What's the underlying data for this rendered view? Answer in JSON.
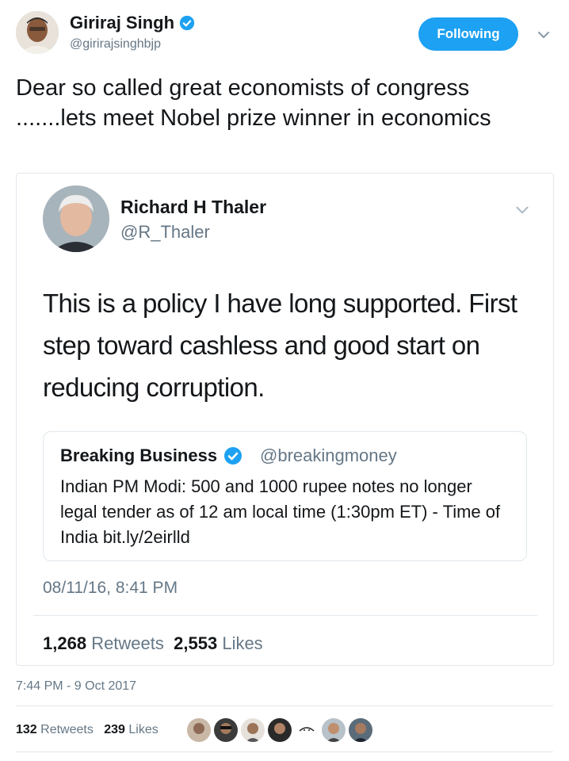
{
  "tweet": {
    "author_name": "Giriraj Singh",
    "author_handle": "@girirajsinghbjp",
    "follow_label": "Following",
    "text": "Dear so called great economists of congress .......lets meet Nobel prize winner in economics",
    "time": "7:44 PM - 9 Oct 2017",
    "retweets_count": "132",
    "retweets_label": "Retweets",
    "likes_count": "239",
    "likes_label": "Likes",
    "icons": {
      "verified": "verified-badge-icon",
      "menu": "chevron-down-icon"
    }
  },
  "quoted": {
    "author_name": "Richard H Thaler",
    "author_handle": "@R_Thaler",
    "text": "This is a policy I have long supported. First step toward cashless and good start on reducing corruption.",
    "date": "08/11/16, 8:41 PM",
    "retweets_count": "1,268",
    "retweets_label": "Retweets",
    "likes_count": "2,553",
    "likes_label": "Likes"
  },
  "inner_quote": {
    "author_name": "Breaking Business",
    "author_handle": "@breakingmoney",
    "text": "Indian PM Modi: 500 and 1000 rupee notes no longer legal tender as of 12 am local time (1:30pm ET) - Time of India bit.ly/2eirlld"
  },
  "colors": {
    "accent": "#1da1f2",
    "muted_text": "#657786",
    "text": "#14171a",
    "border": "#e1e8ed"
  }
}
